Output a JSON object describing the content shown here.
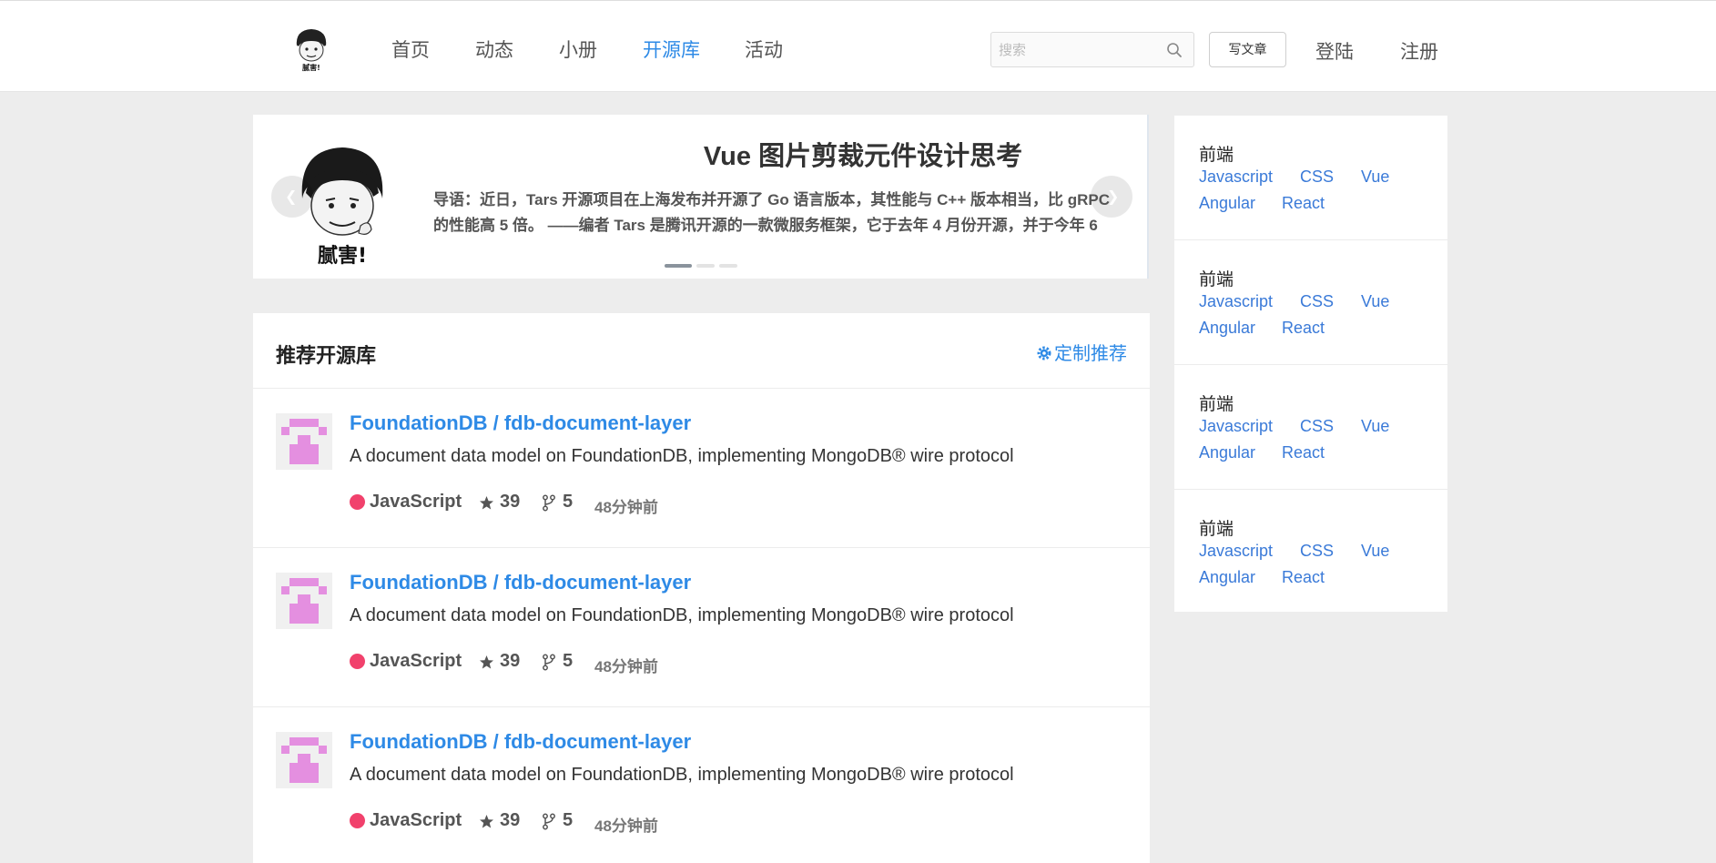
{
  "header": {
    "nav": [
      "首页",
      "动态",
      "小册",
      "开源库",
      "活动"
    ],
    "active_nav": "开源库",
    "search_placeholder": "搜索",
    "write_label": "写文章",
    "login_label": "登陆",
    "register_label": "注册",
    "logo_caption": "腻害!"
  },
  "banner": {
    "title": "Vue 图片剪裁元件设计思考",
    "text": "导语：近日，Tars 开源项目在上海发布并开源了 Go 语言版本，其性能与 C++ 版本相当，比 gRPC 的性能高 5 倍。 ——编者 Tars 是腾讯开源的一款微服务框架，它于去年 4 月份开源，并于今年 6",
    "image_caption": "腻害!",
    "slides": 3,
    "active_slide": 1
  },
  "recommend": {
    "title": "推荐开源库",
    "custom_label": "定制推荐",
    "repos": [
      {
        "name": "FoundationDB / fdb-document-layer",
        "desc": "A document data model on FoundationDB, implementing MongoDB® wire protocol",
        "lang": "JavaScript",
        "stars": "39",
        "forks": "5",
        "time": "48分钟前"
      },
      {
        "name": "FoundationDB / fdb-document-layer",
        "desc": "A document data model on FoundationDB, implementing MongoDB® wire protocol",
        "lang": "JavaScript",
        "stars": "39",
        "forks": "5",
        "time": "48分钟前"
      },
      {
        "name": "FoundationDB / fdb-document-layer",
        "desc": "A document data model on FoundationDB, implementing MongoDB® wire protocol",
        "lang": "JavaScript",
        "stars": "39",
        "forks": "5",
        "time": "48分钟前"
      }
    ]
  },
  "sidebar": {
    "groups": [
      {
        "title": "前端",
        "tags": [
          "Javascript",
          "CSS",
          "Vue",
          "Angular",
          "React"
        ]
      },
      {
        "title": "前端",
        "tags": [
          "Javascript",
          "CSS",
          "Vue",
          "Angular",
          "React"
        ]
      },
      {
        "title": "前端",
        "tags": [
          "Javascript",
          "CSS",
          "Vue",
          "Angular",
          "React"
        ]
      },
      {
        "title": "前端",
        "tags": [
          "Javascript",
          "CSS",
          "Vue",
          "Angular",
          "React"
        ]
      }
    ]
  },
  "colors": {
    "accent": "#2e8ae6",
    "lang_javascript": "#f1416c",
    "avatar_pink": "#e48fe0"
  }
}
